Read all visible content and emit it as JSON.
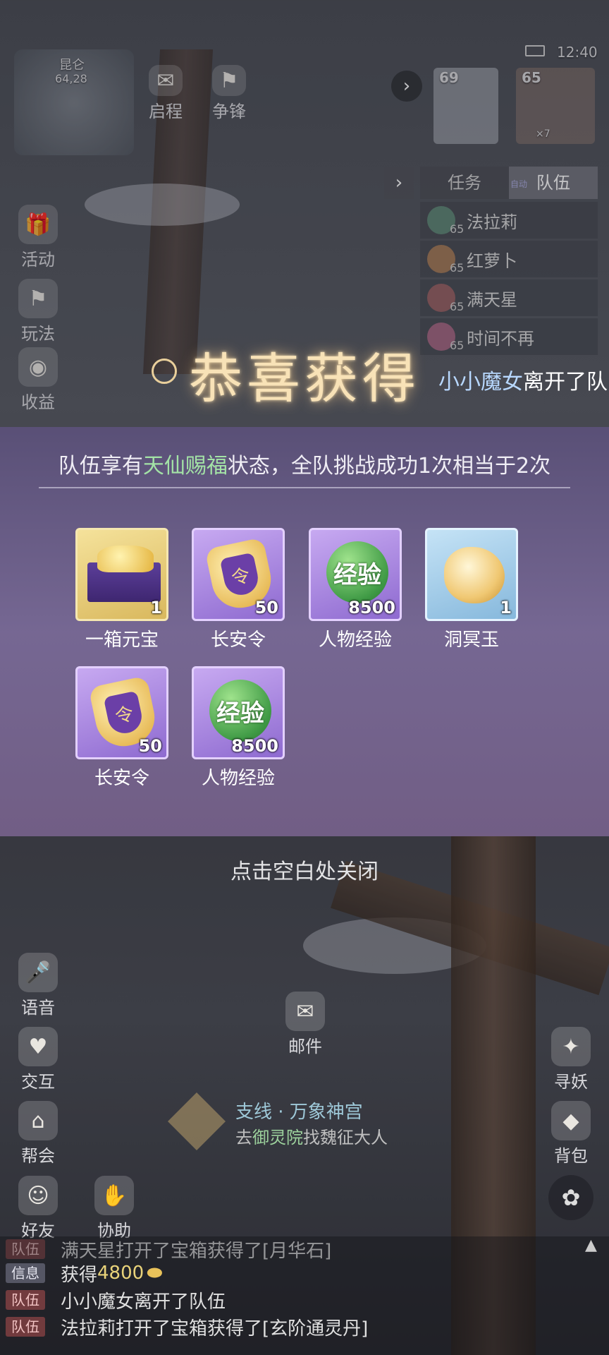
{
  "hud": {
    "map_name": "昆仑",
    "coords": "64,28",
    "time": "12:40",
    "top_buttons": [
      "启程",
      "争锋"
    ],
    "party": [
      {
        "level": "69"
      },
      {
        "level": "65",
        "badge": "×7"
      }
    ]
  },
  "left_menu": [
    "活动",
    "玩法",
    "收益"
  ],
  "bottom_left_menu": [
    "语音",
    "交互",
    "帮会",
    "好友",
    "协助"
  ],
  "right_menu": [
    "寻妖",
    "背包"
  ],
  "mail_label": "邮件",
  "team_panel": {
    "tabs": [
      "任务",
      "队伍"
    ],
    "tab_badge": "自动",
    "members": [
      {
        "name": "法拉莉",
        "level": "65"
      },
      {
        "name": "红萝卜",
        "level": "65"
      },
      {
        "name": "满天星",
        "level": "65"
      },
      {
        "name": "时间不再",
        "level": "65"
      }
    ]
  },
  "popup": {
    "title": "恭喜获得",
    "desc_prefix": "队伍享有",
    "desc_highlight": "天仙赐福",
    "desc_suffix": "状态，全队挑战成功1次相当于2次",
    "items": [
      {
        "name": "一箱元宝",
        "count": "1",
        "quality": "gold",
        "icon": "ingot-chest-icon"
      },
      {
        "name": "长安令",
        "count": "50",
        "quality": "purple",
        "icon": "token-icon",
        "glyph": "令"
      },
      {
        "name": "人物经验",
        "count": "8500",
        "quality": "purple",
        "icon": "exp-orb-icon",
        "glyph": "经验"
      },
      {
        "name": "洞冥玉",
        "count": "1",
        "quality": "blue",
        "icon": "jade-icon"
      },
      {
        "name": "长安令",
        "count": "50",
        "quality": "purple",
        "icon": "token-icon",
        "glyph": "令"
      },
      {
        "name": "人物经验",
        "count": "8500",
        "quality": "purple",
        "icon": "exp-orb-icon",
        "glyph": "经验"
      }
    ],
    "close_hint": "点击空白处关闭"
  },
  "toast": {
    "name": "小小魔女",
    "text": "离开了队"
  },
  "quest": {
    "title": "支线 · 万象神宫",
    "prefix": "去",
    "location": "御灵院",
    "suffix": "找魏征大人"
  },
  "chat": [
    {
      "tag": "队伍",
      "text": "满天星打开了宝箱获得了[月华石]"
    },
    {
      "tag": "信息",
      "prefix": "获得",
      "amount": "4800"
    },
    {
      "tag": "队伍",
      "text": "小小魔女离开了队伍"
    },
    {
      "tag": "队伍",
      "text": "法拉莉打开了宝箱获得了[玄阶通灵丹]"
    }
  ],
  "colors": {
    "highlight_green": "#a3e3a6",
    "title_gold": "#f8e2b7",
    "panel_purple": "#786996"
  }
}
